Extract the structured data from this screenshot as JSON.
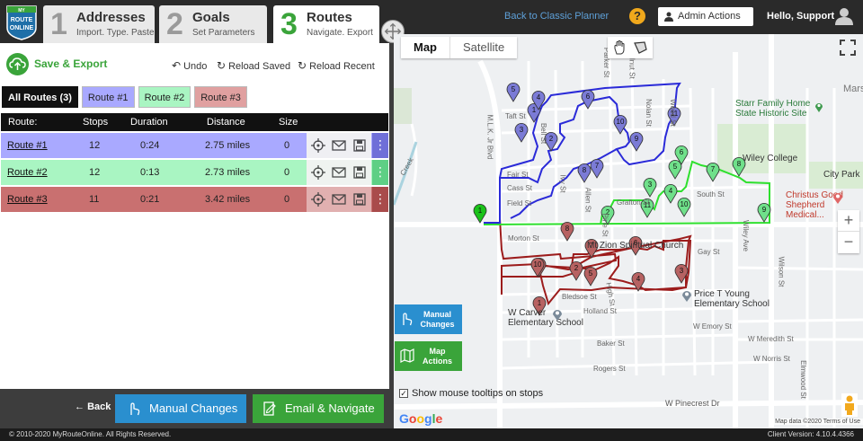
{
  "app": {
    "logo_text": [
      "MY",
      "ROUTE",
      "ONLINE"
    ]
  },
  "steps": [
    {
      "num": "1",
      "title": "Addresses",
      "sub": "Import. Type. Paste"
    },
    {
      "num": "2",
      "title": "Goals",
      "sub": "Set Parameters"
    },
    {
      "num": "3",
      "title": "Routes",
      "sub": "Navigate. Export"
    }
  ],
  "topnav": {
    "back_classic": "Back to Classic Planner",
    "help": "?",
    "admin": "Admin Actions",
    "hello": "Hello, Support"
  },
  "toolbar": {
    "save_export": "Save & Export",
    "undo": "Undo",
    "reload_saved": "Reload Saved",
    "reload_recent": "Reload Recent"
  },
  "route_tabs": [
    {
      "label": "All Routes (3)",
      "color": "#111111"
    },
    {
      "label": "Route #1",
      "color": "#a9a9ff"
    },
    {
      "label": "Route #2",
      "color": "#a9f5c2"
    },
    {
      "label": "Route #3",
      "color": "#e0a0a0"
    }
  ],
  "table": {
    "headers": [
      "Route:",
      "Stops",
      "Duration",
      "Distance",
      "Size"
    ],
    "rows": [
      {
        "route": "Route #1",
        "stops": "12",
        "duration": "0:24",
        "distance": "2.75 miles",
        "size": "0",
        "color": "#a9a9ff",
        "side": "#6f6fd8"
      },
      {
        "route": "Route #2",
        "stops": "12",
        "duration": "0:13",
        "distance": "2.73 miles",
        "size": "0",
        "color": "#a9f5c2",
        "side": "#5ecf85"
      },
      {
        "route": "Route #3",
        "stops": "11",
        "duration": "0:21",
        "distance": "3.42 miles",
        "size": "0",
        "color": "#c97070",
        "side": "#a94b4b"
      }
    ]
  },
  "bottom": {
    "back": "Back",
    "manual": "Manual Changes",
    "email": "Email & Navigate"
  },
  "footer": {
    "copyright": "© 2010-2020  MyRouteOnline. All Rights Reserved.",
    "version": "Client Version: 4.10.4.4366"
  },
  "map": {
    "map_tab": "Map",
    "satellite_tab": "Satellite",
    "manual_btn": [
      "Manual",
      "Changes"
    ],
    "actions_btn": [
      "Map",
      "Actions"
    ],
    "tooltip_label": "Show mouse tooltips on stops",
    "google": "Google",
    "mapdata": "Map data ©2020   Terms of Use",
    "pois": {
      "starr": [
        "Starr Family Home",
        "State Historic Site"
      ],
      "wiley": "Wiley College",
      "citypark": "City Park",
      "christus": [
        "Christus Good",
        "Shepherd Medical..."
      ],
      "mzion": "Mt Zion Spiritual Church",
      "pricety": [
        "Price T Young",
        "Elementary School"
      ],
      "carver": [
        "W Carver",
        "Elementary School"
      ],
      "pinecrest": "W Pinecrest Dr",
      "mars": "Mars",
      "marsh": "Mars"
    },
    "streets": [
      "Parker St",
      "Walnut St",
      "Taft St",
      "Cass St",
      "Field St",
      "Morton St",
      "Grafton St",
      "South St",
      "Holland St",
      "Baker St",
      "Rogers St",
      "Nolan St",
      "Wood St",
      "Bledsoe St",
      "W Emory St",
      "W Meredith St",
      "W Norris St",
      "Wiley Ave",
      "M.L.K. Jr Blvd",
      "High St",
      "Ivy St",
      "Allen St",
      "Fair St",
      "Pine St",
      "Gay St",
      "Bell St",
      "Creek",
      "Wilson St",
      "Elmwood St"
    ],
    "route_colors": {
      "r1": "#2a2ad8",
      "r2": "#2ee02e",
      "r3": "#9c1c1c"
    },
    "stops_r1": [
      "1",
      "2",
      "3",
      "4",
      "5",
      "6",
      "7",
      "8",
      "9",
      "10",
      "11"
    ],
    "stops_r2": [
      "2",
      "3",
      "4",
      "5",
      "6",
      "7",
      "8",
      "9",
      "10",
      "11"
    ],
    "stops_r3": [
      "1",
      "2",
      "3",
      "4",
      "5",
      "6",
      "7",
      "8",
      "9",
      "10"
    ],
    "start": "1"
  }
}
